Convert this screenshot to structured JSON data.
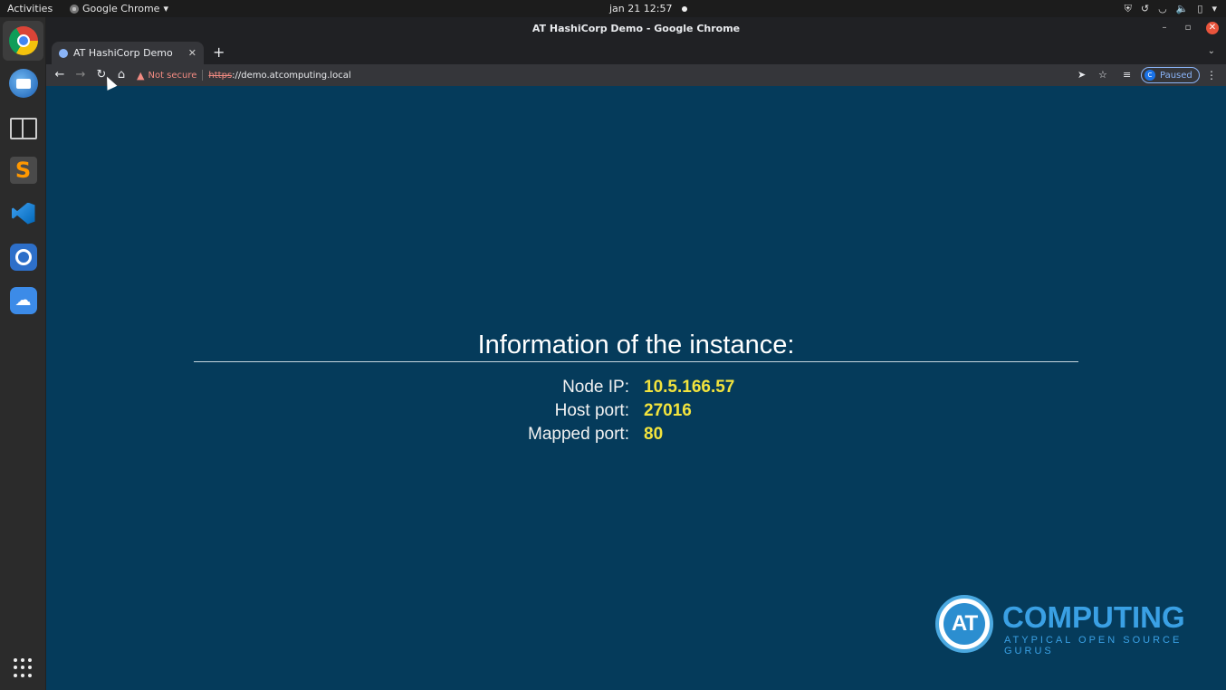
{
  "topbar": {
    "activities": "Activities",
    "app_menu": "Google Chrome",
    "clock": "jan 21  12:57"
  },
  "dock": {
    "items": [
      "Google Chrome",
      "Thunderbird",
      "Terminal",
      "Sublime Text",
      "Visual Studio Code",
      "Timer",
      "Cloud"
    ]
  },
  "window": {
    "title": "AT HashiCorp Demo - Google Chrome"
  },
  "tab": {
    "label": "AT HashiCorp Demo"
  },
  "omnibox": {
    "security": "Not secure",
    "scheme": "https",
    "url_rest": "://demo.atcomputing.local"
  },
  "profile": {
    "initial": "C",
    "status": "Paused"
  },
  "page": {
    "title": "Information of the instance:",
    "rows": [
      {
        "key": "Node IP:",
        "value": "10.5.166.57"
      },
      {
        "key": "Host port:",
        "value": "27016"
      },
      {
        "key": "Mapped port:",
        "value": "80"
      }
    ],
    "logo": {
      "mark": "AT",
      "word": "COMPUTING",
      "tagline": "ATYPICAL OPEN SOURCE GURUS"
    },
    "colors": {
      "background": "#053b5b",
      "value": "#f2e33d",
      "brand": "#3aa0e4"
    }
  }
}
